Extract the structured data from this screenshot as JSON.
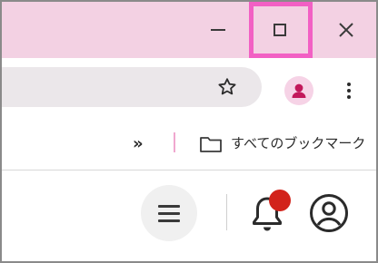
{
  "window_controls": {
    "minimize_icon": "minimize-icon",
    "maximize_icon": "maximize-icon",
    "close_icon": "close-icon",
    "highlight_color": "#f260c4"
  },
  "toolbar": {
    "bookmark_star_icon": "star-icon",
    "profile_icon": "profile-icon",
    "menu_icon": "vertical-dots-icon"
  },
  "bookmarks_bar": {
    "overflow_label": "»",
    "folder_icon": "folder-icon",
    "all_bookmarks_label": "すべてのブックマーク"
  },
  "page": {
    "menu_icon": "hamburger-icon",
    "notifications_icon": "bell-icon",
    "notification_dot_color": "#d2231b",
    "account_icon": "account-circle-icon"
  },
  "colors": {
    "titlebar": "#f3d1e3",
    "omnibox": "#ebe7ea",
    "profile_avatar": "#c2185b"
  }
}
